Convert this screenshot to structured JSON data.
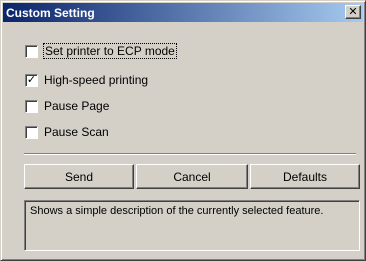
{
  "window": {
    "title": "Custom Setting",
    "close_glyph": "✕"
  },
  "options": [
    {
      "label": "Set printer to ECP mode",
      "checked": false
    },
    {
      "label": "High-speed printing",
      "checked": true
    },
    {
      "label": "Pause Page",
      "checked": false
    },
    {
      "label": "Pause Scan",
      "checked": false
    }
  ],
  "buttons": {
    "send": "Send",
    "cancel": "Cancel",
    "defaults": "Defaults"
  },
  "description": "Shows a simple description of the currently selected feature.",
  "check_glyph": "✓",
  "icons": {
    "close": "close-icon",
    "check": "checkmark-icon"
  }
}
